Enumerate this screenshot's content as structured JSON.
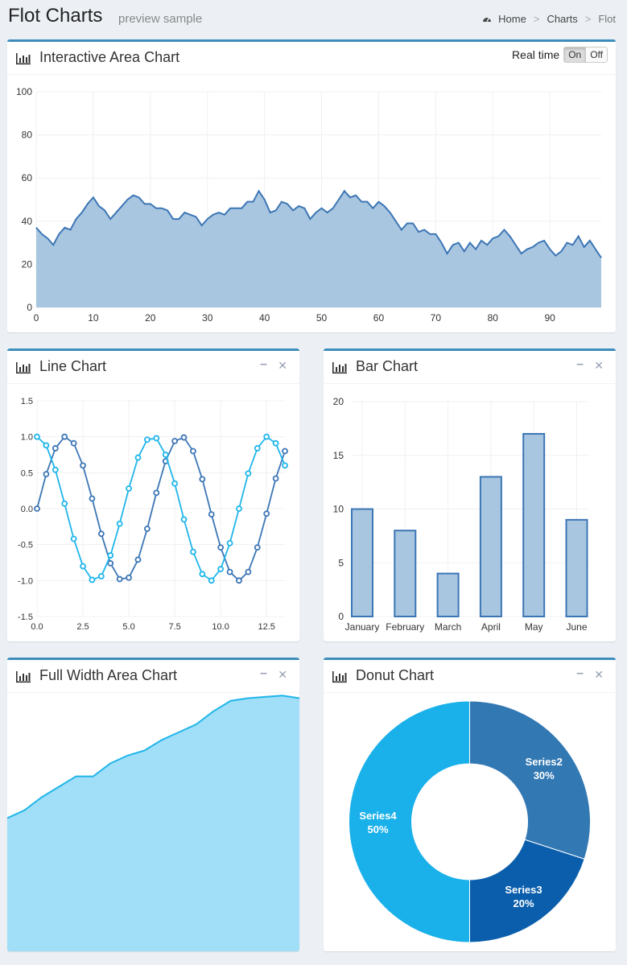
{
  "header": {
    "title": "Flot Charts",
    "subtitle": "preview sample",
    "breadcrumb": [
      "Home",
      "Charts",
      "Flot"
    ]
  },
  "colors": {
    "accent": "#3c8dbc",
    "series_dark": "#3c76b5",
    "series_light": "#1fb5ea",
    "area_fill": "#a9c6e0",
    "full_fill": "#a0dff7"
  },
  "boxes": {
    "interactive": {
      "title": "Interactive Area Chart",
      "realtime_label": "Real time",
      "on_label": "On",
      "off_label": "Off"
    },
    "line": {
      "title": "Line Chart",
      "min_icon": "minus-icon",
      "close_icon": "close-icon"
    },
    "bar": {
      "title": "Bar Chart"
    },
    "full": {
      "title": "Full Width Area Chart"
    },
    "donut": {
      "title": "Donut Chart"
    }
  },
  "chart_data": [
    {
      "id": "interactive",
      "type": "area",
      "title": "Interactive Area Chart",
      "xlim": [
        0,
        99
      ],
      "ylim": [
        0,
        100
      ],
      "xticks": [
        0,
        10,
        20,
        30,
        40,
        50,
        60,
        70,
        80,
        90
      ],
      "yticks": [
        0,
        20,
        40,
        60,
        80,
        100
      ],
      "y": [
        37,
        34,
        32,
        29,
        34,
        37,
        36,
        41,
        44,
        48,
        51,
        47,
        45,
        41,
        44,
        47,
        50,
        52,
        51,
        48,
        48,
        46,
        46,
        45,
        41,
        41,
        44,
        43,
        42,
        38,
        41,
        43,
        44,
        43,
        46,
        46,
        46,
        49,
        49,
        54,
        50,
        44,
        45,
        49,
        48,
        45,
        47,
        46,
        41,
        44,
        46,
        44,
        46,
        50,
        54,
        51,
        52,
        49,
        49,
        46,
        49,
        47,
        44,
        40,
        36,
        39,
        39,
        35,
        36,
        34,
        34,
        30,
        25,
        29,
        30,
        26,
        30,
        27,
        31,
        29,
        32,
        33,
        36,
        33,
        29,
        25,
        27,
        28,
        30,
        31,
        27,
        24,
        26,
        30,
        29,
        33,
        28,
        31,
        27,
        23
      ]
    },
    {
      "id": "line",
      "type": "line",
      "title": "Line Chart",
      "xlim": [
        0,
        13.5
      ],
      "ylim": [
        -1.5,
        1.5
      ],
      "xticks": [
        "0.0",
        "2.5",
        "5.0",
        "7.5",
        "10.0",
        "12.5"
      ],
      "yticks": [
        "1.5",
        "1.0",
        "0.5",
        "0.0",
        "-0.5",
        "-1.0",
        "-1.5"
      ],
      "x": [
        0,
        0.5,
        1,
        1.5,
        2,
        2.5,
        3,
        3.5,
        4,
        4.5,
        5,
        5.5,
        6,
        6.5,
        7,
        7.5,
        8,
        8.5,
        9,
        9.5,
        10,
        10.5,
        11,
        11.5,
        12,
        12.5,
        13,
        13.5
      ],
      "series": [
        {
          "name": "",
          "color": "#3c76b5",
          "values": [
            0.0,
            0.48,
            0.84,
            1.0,
            0.91,
            0.6,
            0.14,
            -0.35,
            -0.76,
            -0.98,
            -0.96,
            -0.71,
            -0.28,
            0.22,
            0.66,
            0.94,
            0.99,
            0.8,
            0.41,
            -0.08,
            -0.54,
            -0.88,
            -1.0,
            -0.88,
            -0.54,
            -0.07,
            0.42,
            0.8
          ]
        },
        {
          "name": "",
          "color": "#1fb5ea",
          "values": [
            1.0,
            0.88,
            0.54,
            0.07,
            -0.42,
            -0.8,
            -0.99,
            -0.94,
            -0.65,
            -0.21,
            0.28,
            0.71,
            0.96,
            0.98,
            0.75,
            0.35,
            -0.15,
            -0.6,
            -0.91,
            -1.0,
            -0.84,
            -0.48,
            0.0,
            0.49,
            0.84,
            1.0,
            0.91,
            0.6
          ]
        }
      ]
    },
    {
      "id": "bar",
      "type": "bar",
      "title": "Bar Chart",
      "categories": [
        "January",
        "February",
        "March",
        "April",
        "May",
        "June"
      ],
      "values": [
        10,
        8,
        4,
        13,
        17,
        9
      ],
      "ylim": [
        0,
        20
      ],
      "yticks": [
        0,
        5,
        10,
        15,
        20
      ]
    },
    {
      "id": "full",
      "type": "area",
      "title": "Full Width Area Chart",
      "ylim": [
        0,
        100
      ],
      "y": [
        52,
        55,
        60,
        64,
        68,
        68,
        73,
        76,
        78,
        82,
        85,
        88,
        93,
        97,
        98,
        98.5,
        99,
        98
      ]
    },
    {
      "id": "donut",
      "type": "pie",
      "title": "Donut Chart",
      "slices": [
        {
          "label": "Series2",
          "percent": "30%",
          "value": 30,
          "color": "#3278b3"
        },
        {
          "label": "Series3",
          "percent": "20%",
          "value": 20,
          "color": "#0a5eac"
        },
        {
          "label": "Series4",
          "percent": "50%",
          "value": 50,
          "color": "#1ab0ea"
        }
      ]
    }
  ]
}
